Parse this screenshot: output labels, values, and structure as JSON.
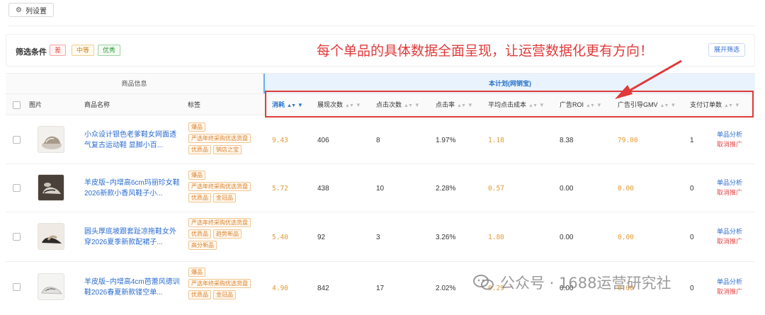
{
  "toolbar": {
    "column_settings_label": "列设置",
    "column_settings_icon": "gear-icon"
  },
  "filter": {
    "label": "筛选条件",
    "tags": [
      "差",
      "中等",
      "优秀"
    ],
    "expand_label": "展开筛选"
  },
  "annotation": "每个单品的具体数据全面呈现，让运营数据化更有方向！",
  "table": {
    "group_product": "商品信息",
    "group_plan": "本计划(网销宝)",
    "headers": {
      "image": "图片",
      "name": "商品名称",
      "tags": "标签",
      "spend": "消耗",
      "impressions": "展现次数",
      "clicks": "点击次数",
      "ctr": "点击率",
      "avg_cpc": "平均点击成本",
      "roi": "广告ROI",
      "gmv": "广告引导GMV",
      "orders": "支付订单数"
    },
    "rows": [
      {
        "name": "小众设计银色老爹鞋女网面透气复古运动鞋 显脚小百...",
        "tags": [
          "爆品",
          "严选年终采购优选货盘",
          "优质品",
          "销店之宝"
        ],
        "spend": "9.43",
        "impressions": "406",
        "clicks": "8",
        "ctr": "1.97%",
        "avg_cpc": "1.18",
        "roi": "8.38",
        "gmv": "79.00",
        "orders": "1",
        "op_analyze": "单品分析",
        "op_cancel": "取消推广"
      },
      {
        "name": "羊皮版~内增高6cm玛丽珍女鞋2026新款小香风鞋子小...",
        "tags": [
          "爆品",
          "严选年终采购优选货盘",
          "优质品",
          "金冠品"
        ],
        "spend": "5.72",
        "impressions": "438",
        "clicks": "10",
        "ctr": "2.28%",
        "avg_cpc": "0.57",
        "roi": "0.00",
        "gmv": "0.00",
        "orders": "0",
        "op_analyze": "单品分析",
        "op_cancel": "取消推广"
      },
      {
        "name": "圆头厚底坡跟套趾凉拖鞋女外穿2026夏季新款配裙子...",
        "tags": [
          "严选年终采购优选货盘",
          "优质品",
          "趋势新品",
          "高分新品"
        ],
        "spend": "5.40",
        "impressions": "92",
        "clicks": "3",
        "ctr": "3.26%",
        "avg_cpc": "1.80",
        "roi": "0.00",
        "gmv": "0.00",
        "orders": "0",
        "op_analyze": "单品分析",
        "op_cancel": "取消推广"
      },
      {
        "name": "羊皮版~内增高4cm芭蕾风德训鞋2026春夏新款镂空单...",
        "tags": [
          "爆品",
          "严选年终采购优选货盘",
          "优质品",
          "金冠品"
        ],
        "spend": "4.90",
        "impressions": "842",
        "clicks": "17",
        "ctr": "2.02%",
        "avg_cpc": "0.29",
        "roi": "0.00",
        "gmv": "0.00",
        "orders": "0",
        "op_analyze": "单品分析",
        "op_cancel": "取消推广"
      }
    ]
  },
  "watermark": "公众号 · 1688运营研究社"
}
